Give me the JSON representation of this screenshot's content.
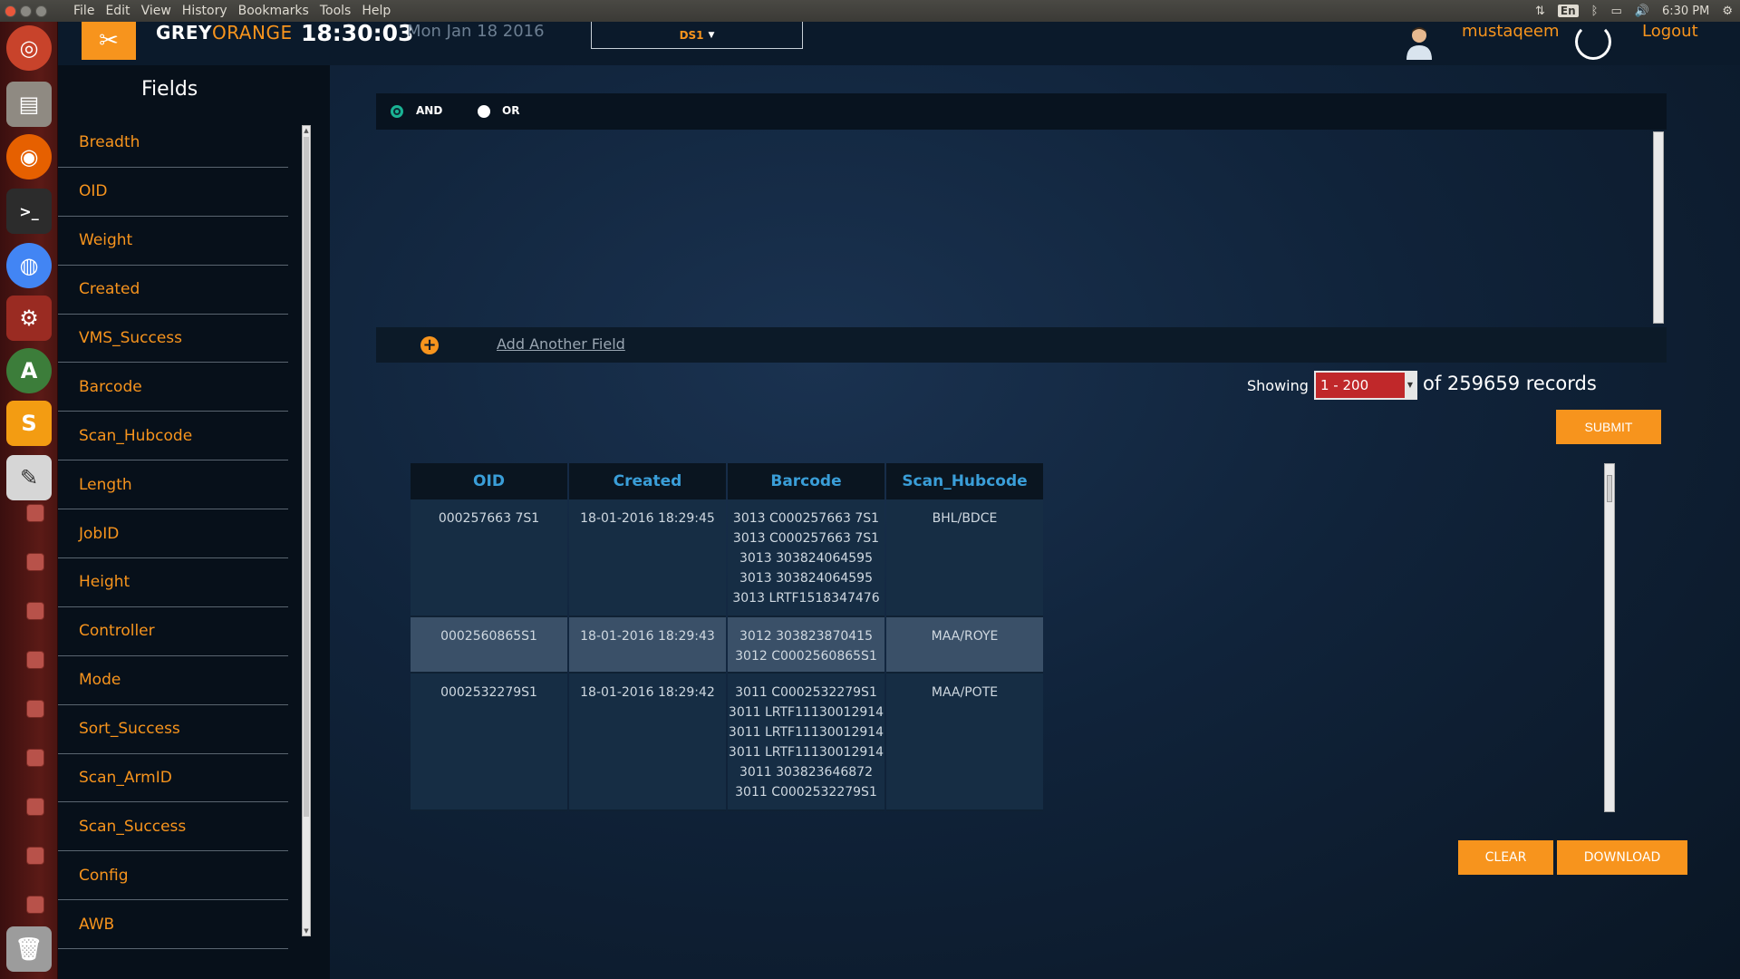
{
  "os": {
    "menu": [
      "File",
      "Edit",
      "View",
      "History",
      "Bookmarks",
      "Tools",
      "Help"
    ],
    "tray": {
      "lang": "En",
      "time": "6:30 PM"
    }
  },
  "launcher": {
    "icons": [
      "ubuntu-dash-icon",
      "file-manager-icon",
      "firefox-icon",
      "terminal-icon",
      "chrome-icon",
      "system-settings-icon",
      "software-updater-icon",
      "sublime-text-icon",
      "text-editor-icon",
      "trash-icon"
    ]
  },
  "header": {
    "brand_grey": "GREY",
    "brand_orange": "ORANGE",
    "clock": "18:30:03",
    "date": "Mon Jan 18 2016",
    "ds_selector": "DS1",
    "username": "mustaqeem",
    "logout": "Logout"
  },
  "sidebar": {
    "title": "Fields",
    "fields": [
      "Breadth",
      "OID",
      "Weight",
      "Created",
      "VMS_Success",
      "Barcode",
      "Scan_Hubcode",
      "Length",
      "JobID",
      "Height",
      "Controller",
      "Mode",
      "Sort_Success",
      "Scan_ArmID",
      "Scan_Success",
      "Config",
      "AWB"
    ]
  },
  "query": {
    "and_label": "AND",
    "or_label": "OR",
    "selected": "AND",
    "add_field_label": "Add Another Field"
  },
  "pagination": {
    "showing_label": "Showing :",
    "range": "1 - 200",
    "records_text": "of 259659 records",
    "submit_label": "SUBMIT"
  },
  "results": {
    "columns": [
      "OID",
      "Created",
      "Barcode",
      "Scan_Hubcode"
    ],
    "rows": [
      {
        "oid": "000257663 7S1",
        "created": "18-01-2016 18:29:45",
        "barcodes": [
          "3013 C000257663 7S1",
          "3013 C000257663 7S1",
          "3013 303824064595",
          "3013 303824064595",
          "3013 LRTF1518347476"
        ],
        "hub": "BHL/BDCE"
      },
      {
        "oid": "0002560865S1",
        "created": "18-01-2016 18:29:43",
        "barcodes": [
          "3012 303823870415",
          "3012 C0002560865S1"
        ],
        "hub": "MAA/ROYE"
      },
      {
        "oid": "0002532279S1",
        "created": "18-01-2016 18:29:42",
        "barcodes": [
          "3011 C0002532279S1",
          "3011 LRTF11130012914",
          "3011 LRTF11130012914",
          "3011 LRTF11130012914",
          "3011 303823646872",
          "3011 C0002532279S1"
        ],
        "hub": "MAA/POTE"
      }
    ]
  },
  "actions": {
    "clear_label": "CLEAR",
    "download_label": "DOWNLOAD"
  },
  "colors": {
    "accent": "#f7941d",
    "header_bg": "#0b1a2b",
    "table_header_text": "#3a9ed8"
  }
}
